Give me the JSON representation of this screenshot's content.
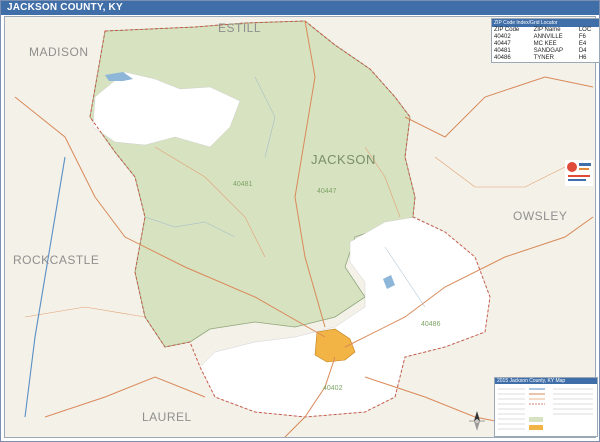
{
  "header": {
    "title": "JACKSON COUNTY, KY"
  },
  "map": {
    "counties": {
      "estill": "ESTILL",
      "madison": "MADISON",
      "jackson": "JACKSON",
      "owsley": "OWSLEY",
      "rockcastle": "ROCKCASTLE",
      "laurel": "LAUREL"
    },
    "zip_labels": [
      "40481",
      "40447",
      "40486",
      "40402"
    ]
  },
  "zip_index": {
    "title": "ZIP Code Index/Grid Locator",
    "columns": [
      "ZIP Code",
      "ZIP Name",
      "LOC"
    ],
    "rows": [
      [
        "40402",
        "ANNVILLE",
        "F6"
      ],
      [
        "40447",
        "MC KEE",
        "E4"
      ],
      [
        "40481",
        "SANDGAP",
        "D4"
      ],
      [
        "40486",
        "TYNER",
        "H6"
      ]
    ]
  },
  "legend": {
    "title": "2015 Jackson County, KY Map"
  },
  "colors": {
    "forest": "#d9e4c4",
    "header": "#3f6ea8",
    "roads": "#d98a5a",
    "city": "#f6b93b",
    "water": "#8eb6d8"
  }
}
